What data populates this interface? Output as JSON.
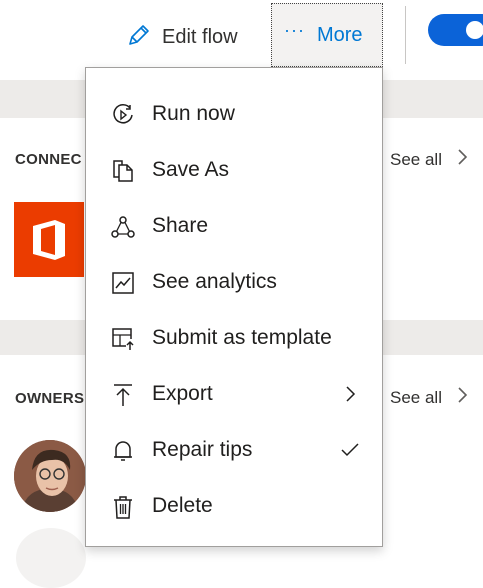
{
  "toolbar": {
    "edit_flow_label": "Edit flow",
    "more_label": "More",
    "toggle_on": true
  },
  "sections": {
    "connections": {
      "label": "CONNEC",
      "see_all": "See all"
    },
    "owners": {
      "label": "OWNERS",
      "see_all": "See all"
    }
  },
  "menu": {
    "items": [
      {
        "label": "Run now",
        "icon": "run-now-icon"
      },
      {
        "label": "Save As",
        "icon": "save-as-icon"
      },
      {
        "label": "Share",
        "icon": "share-icon"
      },
      {
        "label": "See analytics",
        "icon": "analytics-icon"
      },
      {
        "label": "Submit as template",
        "icon": "template-icon"
      },
      {
        "label": "Export",
        "icon": "export-icon",
        "submenu": true
      },
      {
        "label": "Repair tips",
        "icon": "bell-icon",
        "checked": true
      },
      {
        "label": "Delete",
        "icon": "trash-icon"
      }
    ]
  },
  "colors": {
    "accent": "#0078d4",
    "toggle": "#0b63d8",
    "office": "#eb3c00",
    "band": "#edebe9"
  }
}
